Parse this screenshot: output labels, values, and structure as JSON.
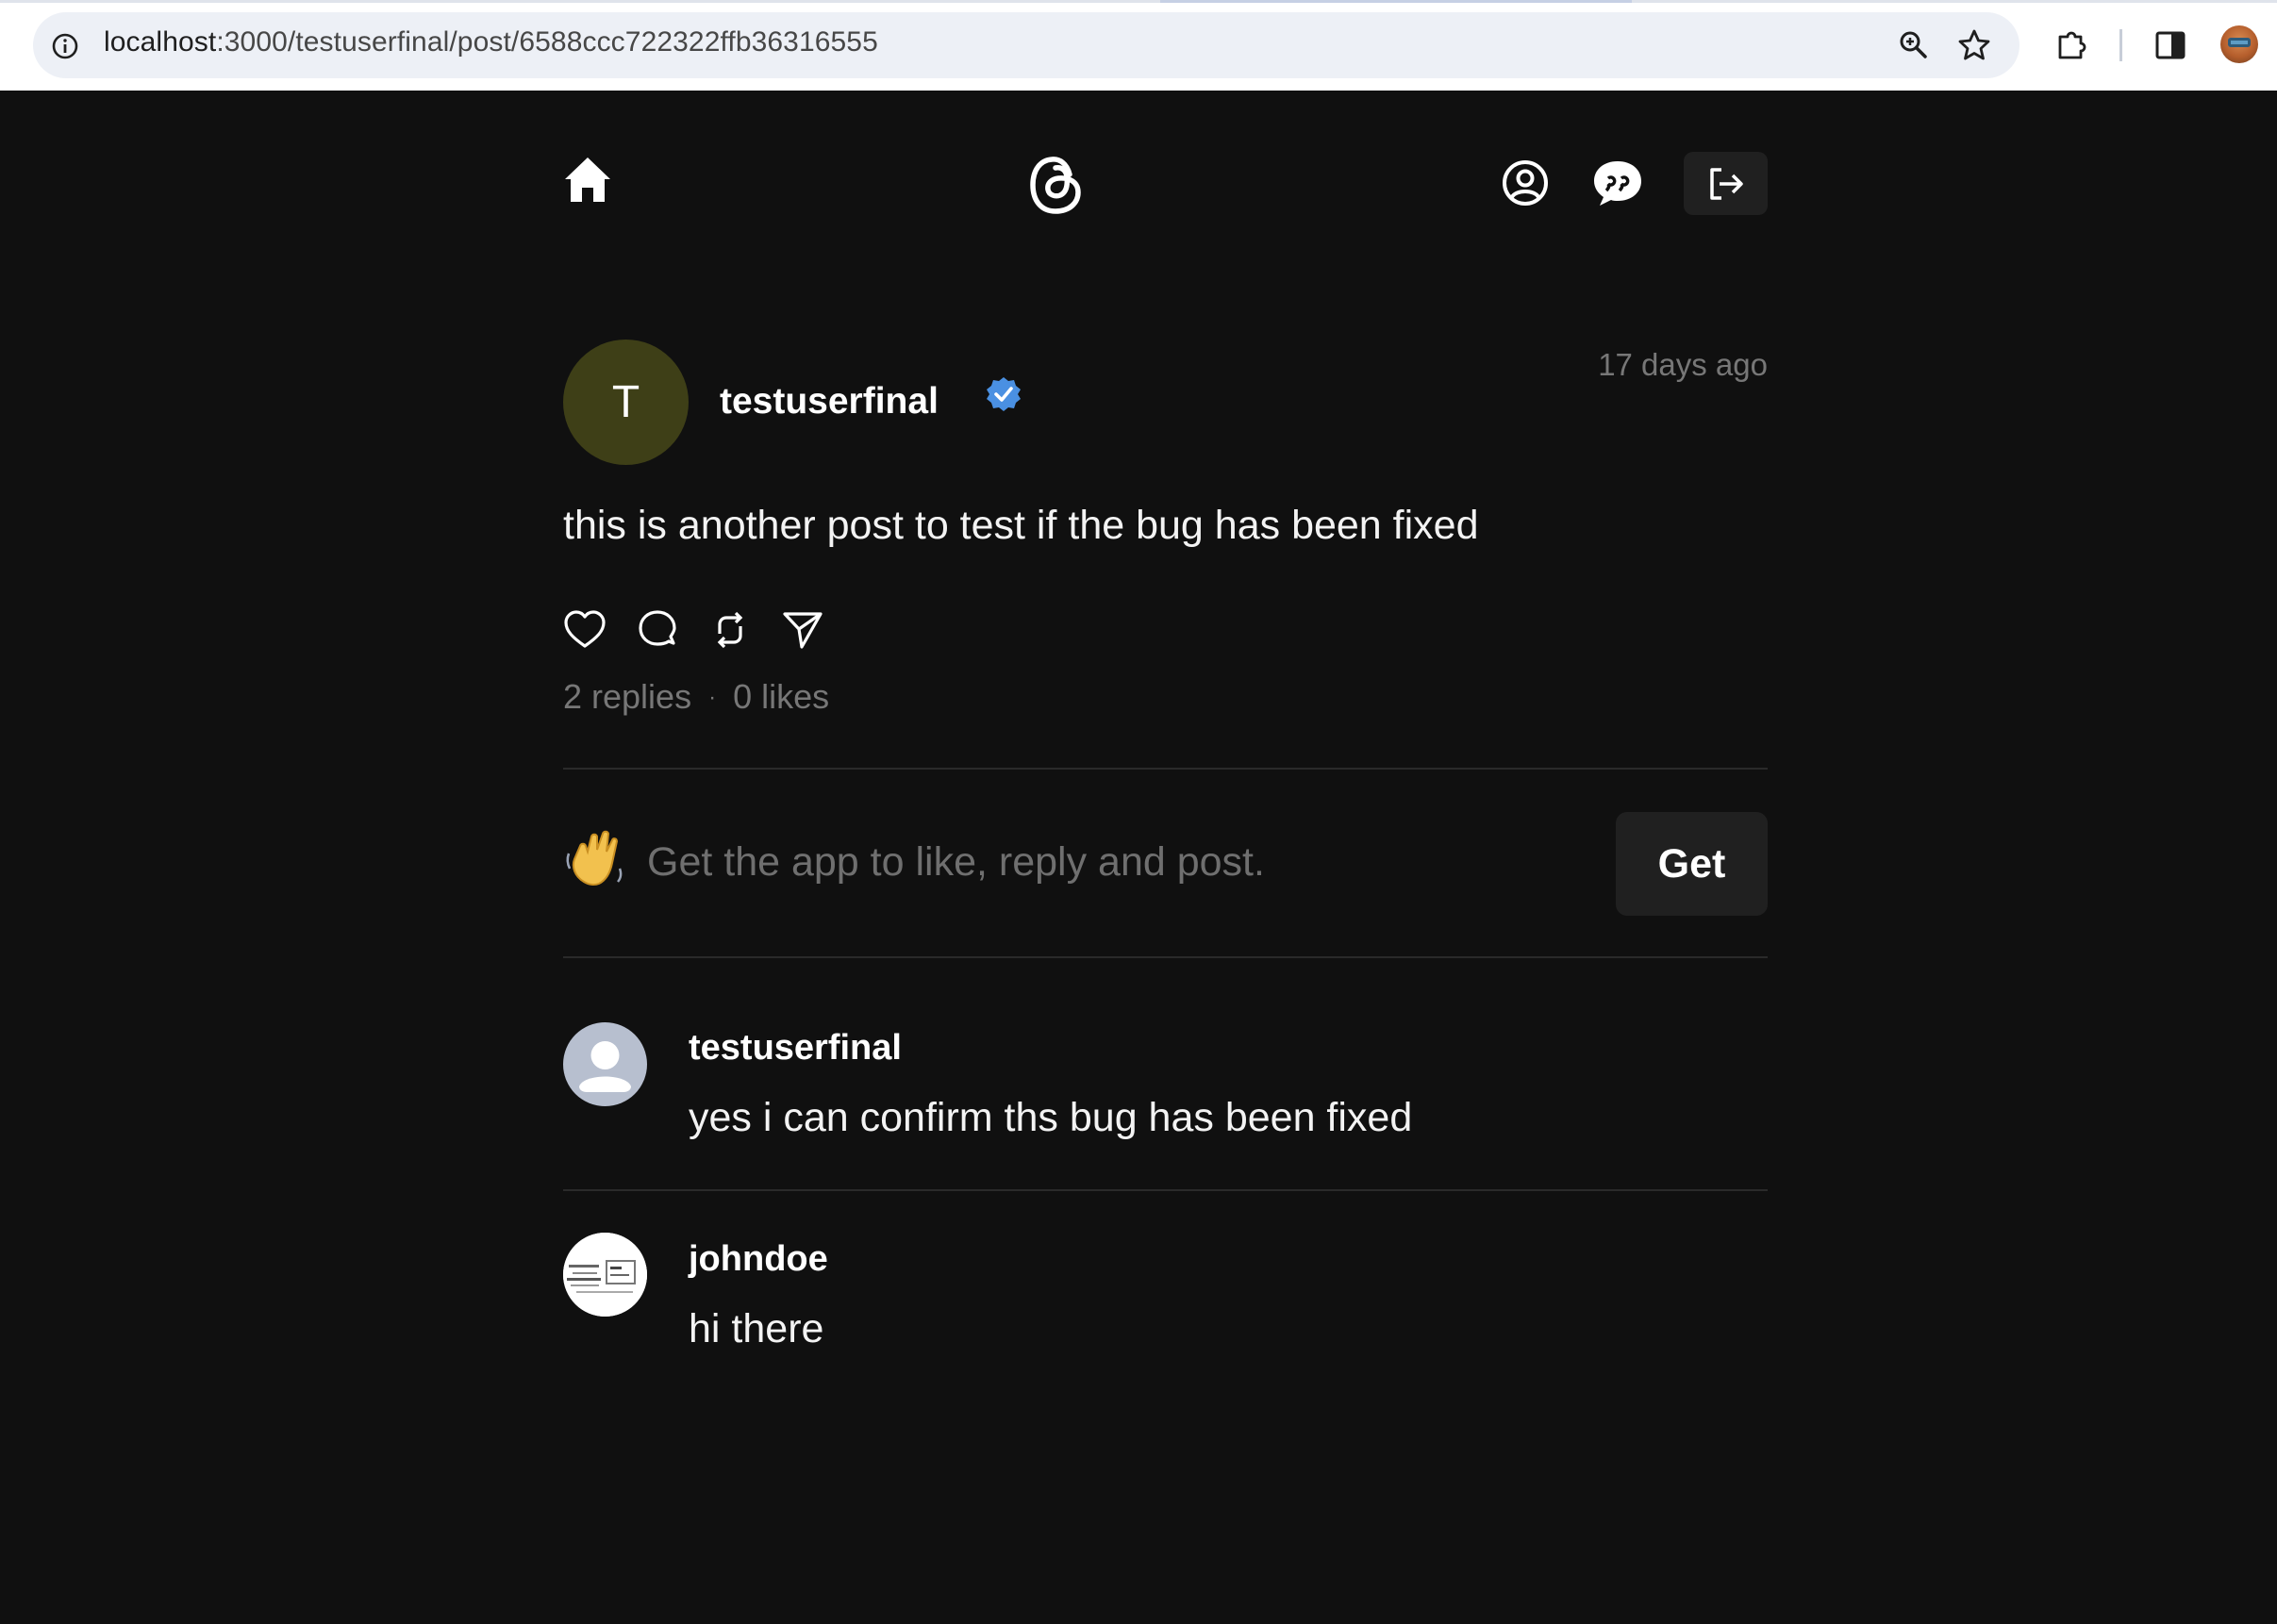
{
  "browser": {
    "url_host": "localhost",
    "url_path": ":3000/testuserfinal/post/6588ccc722322ffb36316555",
    "icons": [
      "info-icon",
      "zoom-icon",
      "bookmark-star-icon",
      "extensions-icon",
      "side-panel-icon",
      "profile-avatar"
    ]
  },
  "nav": {
    "icons": [
      "home-icon",
      "threads-logo",
      "profile-icon",
      "chat-icon",
      "logout-icon"
    ]
  },
  "post": {
    "avatar_letter": "T",
    "username": "testuserfinal",
    "time": "17 days ago",
    "text": "this is another post to test if the bug has been fixed",
    "actions": [
      "like-icon",
      "reply-icon",
      "repost-icon",
      "share-icon"
    ],
    "replies": "2 replies",
    "separator": "·",
    "likes": "0 likes"
  },
  "promo": {
    "text": "Get the app to like, reply and post.",
    "button": "Get"
  },
  "replies": [
    {
      "username": "testuserfinal",
      "text": "yes i can confirm ths bug has been fixed"
    },
    {
      "username": "johndoe",
      "text": "hi there"
    }
  ],
  "colors": {
    "background": "#101010",
    "verified": "#4a90e2",
    "muted_text": "#777777",
    "avatar_bg": "#3e3f17"
  }
}
